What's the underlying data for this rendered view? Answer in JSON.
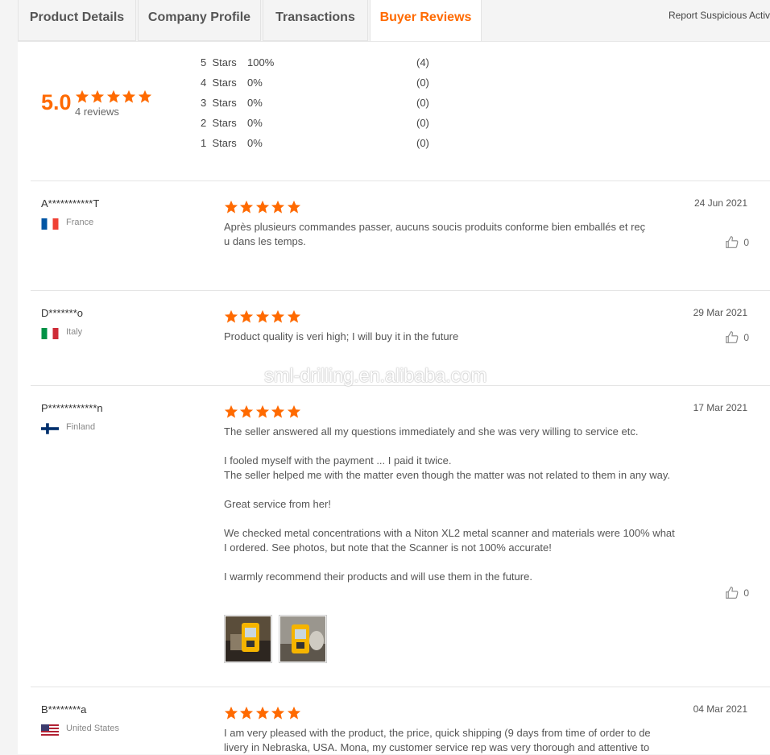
{
  "tabs": [
    {
      "label": "Product Details"
    },
    {
      "label": "Company Profile"
    },
    {
      "label": "Transactions"
    },
    {
      "label": "Buyer Reviews"
    }
  ],
  "report_link": "Report Suspicious Activ",
  "summary": {
    "average": "5.0",
    "star_rating": 5,
    "count_text": "4 reviews",
    "breakdown": [
      {
        "label": "5  Stars",
        "percent": "100%",
        "count": "(4)"
      },
      {
        "label": "4  Stars",
        "percent": "0%",
        "count": "(0)"
      },
      {
        "label": "3  Stars",
        "percent": "0%",
        "count": "(0)"
      },
      {
        "label": "2  Stars",
        "percent": "0%",
        "count": "(0)"
      },
      {
        "label": "1  Stars",
        "percent": "0%",
        "count": "(0)"
      }
    ]
  },
  "reviews": [
    {
      "name": "A***********T",
      "country": "France",
      "flag_icon": "france-flag-icon",
      "rating": 5,
      "date": "24 Jun 2021",
      "paragraphs": [
        "Après plusieurs commandes passer, aucuns soucis produits conforme bien emballés et reç\nu dans les temps."
      ],
      "likes": "0"
    },
    {
      "name": "D*******o",
      "country": "Italy",
      "flag_icon": "italy-flag-icon",
      "rating": 5,
      "date": "29 Mar 2021",
      "paragraphs": [
        "Product quality is veri high; I will buy it in the future"
      ],
      "likes": "0"
    },
    {
      "name": "P************n",
      "country": "Finland",
      "flag_icon": "finland-flag-icon",
      "rating": 5,
      "date": "17 Mar 2021",
      "paragraphs": [
        "The seller answered all my questions immediately and she was very willing to service etc.",
        "I fooled myself with the payment ... I paid it twice.\nThe seller helped me with the matter even though the matter was not related to them in any way.",
        "Great service from her!",
        "We checked metal concentrations with a Niton XL2 metal scanner and materials were 100% what I ordered. See photos, but note that the Scanner is not 100% accurate!",
        "I warmly recommend their products and will use them in the future."
      ],
      "likes": "0"
    },
    {
      "name": "B********a",
      "country": "United States",
      "flag_icon": "usa-flag-icon",
      "rating": 5,
      "date": "04 Mar 2021",
      "paragraphs": [
        "I am very pleased with the product, the price, quick shipping (9 days from time of order to de\nlivery in Nebraska, USA. Mona, my customer service rep was very thorough and attentive to"
      ],
      "likes": ""
    }
  ],
  "watermark": "sml-drilling.en.alibaba.com",
  "colors": {
    "accent": "#ff6a00",
    "star": "#ff6a00"
  }
}
